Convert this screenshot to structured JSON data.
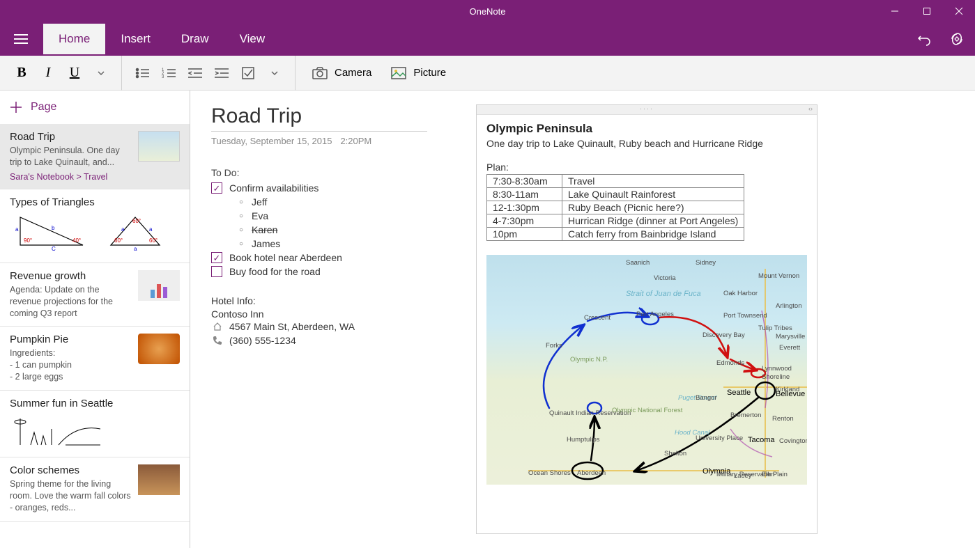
{
  "app": {
    "title": "OneNote"
  },
  "tabs": {
    "home": "Home",
    "insert": "Insert",
    "draw": "Draw",
    "view": "View"
  },
  "ribbon": {
    "camera": "Camera",
    "picture": "Picture"
  },
  "sidebar": {
    "add_page": "Page",
    "items": [
      {
        "title": "Road Trip",
        "snippet": "Olympic Peninsula. One day trip to Lake Quinault, and...",
        "breadcrumb": "Sara's Notebook > Travel"
      },
      {
        "title": "Types of Triangles"
      },
      {
        "title": "Revenue growth",
        "snippet": "Agenda: Update on the revenue projections for the coming Q3 report"
      },
      {
        "title": "Pumpkin Pie",
        "snippet": "Ingredients:\n- 1 can pumpkin\n- 2 large eggs"
      },
      {
        "title": "Summer fun in Seattle"
      },
      {
        "title": "Color schemes",
        "snippet": "Spring theme for the living room. Love the warm fall colors - oranges, reds..."
      }
    ]
  },
  "note": {
    "title": "Road Trip",
    "date": "Tuesday, September 15, 2015",
    "time": "2:20PM",
    "todo_header": "To Do:",
    "todos": [
      {
        "label": "Confirm availabilities",
        "checked": true,
        "subs": [
          "Jeff",
          "Eva",
          "Karen",
          "James"
        ],
        "strike_index": 2
      },
      {
        "label": "Book hotel near Aberdeen",
        "checked": true
      },
      {
        "label": "Buy food for the road",
        "checked": false
      }
    ],
    "hotel": {
      "header": "Hotel Info:",
      "name": "Contoso Inn",
      "address": "4567 Main St, Aberdeen, WA",
      "phone": "(360) 555-1234"
    }
  },
  "embed": {
    "title": "Olympic Peninsula",
    "desc": "One day trip to Lake Quinault, Ruby beach and Hurricane Ridge",
    "plan_label": "Plan:",
    "rows": [
      [
        "7:30-8:30am",
        "Travel"
      ],
      [
        "8:30-11am",
        "Lake Quinault Rainforest"
      ],
      [
        "12-1:30pm",
        "Ruby Beach (Picnic here?)"
      ],
      [
        "4-7:30pm",
        "Hurrican Ridge (dinner at Port Angeles)"
      ],
      [
        "10pm",
        "Catch ferry from Bainbridge Island"
      ]
    ],
    "map_labels": {
      "saanich": "Saanich",
      "victoria": "Victoria",
      "sidney": "Sidney",
      "strait": "Strait of Juan de Fuca",
      "oak_harbor": "Oak Harbor",
      "mt_vernon": "Mount Vernon",
      "port_angeles": "Port Angeles",
      "crescent": "Crescent",
      "port_townsend": "Port Townsend",
      "arlington": "Arlington",
      "tulip": "Tulip Tribes",
      "marysville": "Marysville",
      "discovery": "Discovery Bay",
      "everett": "Everett",
      "forks": "Forks",
      "olympic_np": "Olympic N.P.",
      "edmonds": "Edmonds",
      "lynnwood": "Lynnwood",
      "shoreline": "Shoreline",
      "kirkland": "Kirkland",
      "seattle": "Seattle",
      "bellevue": "Bellevue",
      "puget": "Puget Sound",
      "bangor": "Bangor",
      "quinault": "Quinault Indian Reservation",
      "onf": "Olympic National Forest",
      "bremerton": "Bremerton",
      "renton": "Renton",
      "hood": "Hood Canal",
      "humptulips": "Humptulips",
      "university": "University Place",
      "tacoma": "Tacoma",
      "covington": "Covington",
      "shelton": "Shelton",
      "ocean": "Ocean Shores",
      "aberdeen": "Aberdeen",
      "olympia": "Olympia",
      "lacey": "Lacey",
      "military": "Military Reservation",
      "elk": "Elk Plain"
    }
  }
}
